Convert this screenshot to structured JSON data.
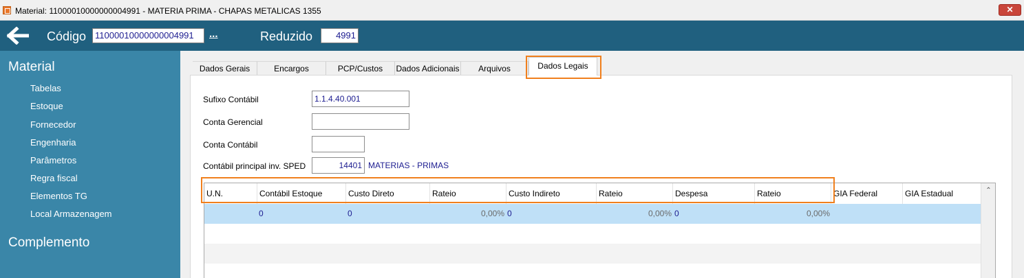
{
  "window": {
    "title": "Material: 11000010000000004991 - MATERIA PRIMA - CHAPAS METALICAS 1355",
    "close_label": "✕"
  },
  "header": {
    "codigo_label": "Código",
    "codigo_value": "11000010000000004991",
    "lookup_label": "...",
    "reduzido_label": "Reduzido",
    "reduzido_value": "4991"
  },
  "sidebar": {
    "section1": "Material",
    "items": [
      "Tabelas",
      "Estoque",
      "Fornecedor",
      "Engenharia",
      "Parâmetros",
      "Regra fiscal",
      "Elementos TG",
      "Local Armazenagem"
    ],
    "section2": "Complemento"
  },
  "tabs": [
    "Dados Gerais",
    "Encargos",
    "PCP/Custos",
    "Dados Adicionais",
    "Arquivos",
    "Dados Legais"
  ],
  "active_tab": "Dados Legais",
  "form": {
    "sufixo_label": "Sufixo Contábil",
    "sufixo_value": "1.1.4.40.001",
    "conta_gerencial_label": "Conta Gerencial",
    "conta_gerencial_value": "",
    "conta_contabil_label": "Conta Contábil",
    "conta_contabil_value": "",
    "sped_label": "Contábil principal inv. SPED",
    "sped_value": "14401",
    "sped_desc": "MATERIAS - PRIMAS"
  },
  "grid": {
    "columns": [
      "U.N.",
      "Contábil Estoque",
      "Custo Direto",
      "Rateio",
      "Custo Indireto",
      "Rateio",
      "Despesa",
      "Rateio",
      "GIA Federal",
      "GIA Estadual"
    ],
    "rows": [
      [
        "",
        "0",
        "0",
        "0,00%",
        "0",
        "0,00%",
        "0",
        "0,00%",
        "",
        ""
      ]
    ]
  },
  "colors": {
    "header_bg": "#20607f",
    "sidebar_bg": "#3a86a8",
    "highlight": "#f07f1c",
    "selected_row": "#bfe0f7"
  }
}
